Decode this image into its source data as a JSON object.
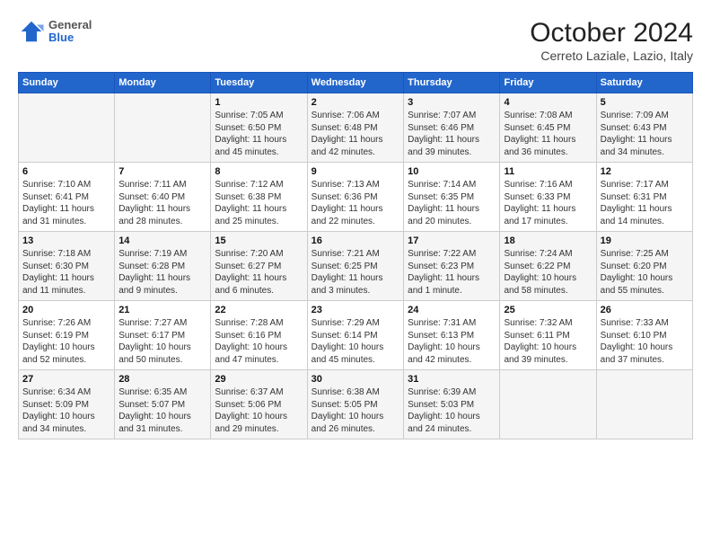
{
  "header": {
    "logo_general": "General",
    "logo_blue": "Blue",
    "title": "October 2024",
    "subtitle": "Cerreto Laziale, Lazio, Italy"
  },
  "days_of_week": [
    "Sunday",
    "Monday",
    "Tuesday",
    "Wednesday",
    "Thursday",
    "Friday",
    "Saturday"
  ],
  "weeks": [
    [
      {
        "day": "",
        "info": ""
      },
      {
        "day": "",
        "info": ""
      },
      {
        "day": "1",
        "info": "Sunrise: 7:05 AM\nSunset: 6:50 PM\nDaylight: 11 hours and 45 minutes."
      },
      {
        "day": "2",
        "info": "Sunrise: 7:06 AM\nSunset: 6:48 PM\nDaylight: 11 hours and 42 minutes."
      },
      {
        "day": "3",
        "info": "Sunrise: 7:07 AM\nSunset: 6:46 PM\nDaylight: 11 hours and 39 minutes."
      },
      {
        "day": "4",
        "info": "Sunrise: 7:08 AM\nSunset: 6:45 PM\nDaylight: 11 hours and 36 minutes."
      },
      {
        "day": "5",
        "info": "Sunrise: 7:09 AM\nSunset: 6:43 PM\nDaylight: 11 hours and 34 minutes."
      }
    ],
    [
      {
        "day": "6",
        "info": "Sunrise: 7:10 AM\nSunset: 6:41 PM\nDaylight: 11 hours and 31 minutes."
      },
      {
        "day": "7",
        "info": "Sunrise: 7:11 AM\nSunset: 6:40 PM\nDaylight: 11 hours and 28 minutes."
      },
      {
        "day": "8",
        "info": "Sunrise: 7:12 AM\nSunset: 6:38 PM\nDaylight: 11 hours and 25 minutes."
      },
      {
        "day": "9",
        "info": "Sunrise: 7:13 AM\nSunset: 6:36 PM\nDaylight: 11 hours and 22 minutes."
      },
      {
        "day": "10",
        "info": "Sunrise: 7:14 AM\nSunset: 6:35 PM\nDaylight: 11 hours and 20 minutes."
      },
      {
        "day": "11",
        "info": "Sunrise: 7:16 AM\nSunset: 6:33 PM\nDaylight: 11 hours and 17 minutes."
      },
      {
        "day": "12",
        "info": "Sunrise: 7:17 AM\nSunset: 6:31 PM\nDaylight: 11 hours and 14 minutes."
      }
    ],
    [
      {
        "day": "13",
        "info": "Sunrise: 7:18 AM\nSunset: 6:30 PM\nDaylight: 11 hours and 11 minutes."
      },
      {
        "day": "14",
        "info": "Sunrise: 7:19 AM\nSunset: 6:28 PM\nDaylight: 11 hours and 9 minutes."
      },
      {
        "day": "15",
        "info": "Sunrise: 7:20 AM\nSunset: 6:27 PM\nDaylight: 11 hours and 6 minutes."
      },
      {
        "day": "16",
        "info": "Sunrise: 7:21 AM\nSunset: 6:25 PM\nDaylight: 11 hours and 3 minutes."
      },
      {
        "day": "17",
        "info": "Sunrise: 7:22 AM\nSunset: 6:23 PM\nDaylight: 11 hours and 1 minute."
      },
      {
        "day": "18",
        "info": "Sunrise: 7:24 AM\nSunset: 6:22 PM\nDaylight: 10 hours and 58 minutes."
      },
      {
        "day": "19",
        "info": "Sunrise: 7:25 AM\nSunset: 6:20 PM\nDaylight: 10 hours and 55 minutes."
      }
    ],
    [
      {
        "day": "20",
        "info": "Sunrise: 7:26 AM\nSunset: 6:19 PM\nDaylight: 10 hours and 52 minutes."
      },
      {
        "day": "21",
        "info": "Sunrise: 7:27 AM\nSunset: 6:17 PM\nDaylight: 10 hours and 50 minutes."
      },
      {
        "day": "22",
        "info": "Sunrise: 7:28 AM\nSunset: 6:16 PM\nDaylight: 10 hours and 47 minutes."
      },
      {
        "day": "23",
        "info": "Sunrise: 7:29 AM\nSunset: 6:14 PM\nDaylight: 10 hours and 45 minutes."
      },
      {
        "day": "24",
        "info": "Sunrise: 7:31 AM\nSunset: 6:13 PM\nDaylight: 10 hours and 42 minutes."
      },
      {
        "day": "25",
        "info": "Sunrise: 7:32 AM\nSunset: 6:11 PM\nDaylight: 10 hours and 39 minutes."
      },
      {
        "day": "26",
        "info": "Sunrise: 7:33 AM\nSunset: 6:10 PM\nDaylight: 10 hours and 37 minutes."
      }
    ],
    [
      {
        "day": "27",
        "info": "Sunrise: 6:34 AM\nSunset: 5:09 PM\nDaylight: 10 hours and 34 minutes."
      },
      {
        "day": "28",
        "info": "Sunrise: 6:35 AM\nSunset: 5:07 PM\nDaylight: 10 hours and 31 minutes."
      },
      {
        "day": "29",
        "info": "Sunrise: 6:37 AM\nSunset: 5:06 PM\nDaylight: 10 hours and 29 minutes."
      },
      {
        "day": "30",
        "info": "Sunrise: 6:38 AM\nSunset: 5:05 PM\nDaylight: 10 hours and 26 minutes."
      },
      {
        "day": "31",
        "info": "Sunrise: 6:39 AM\nSunset: 5:03 PM\nDaylight: 10 hours and 24 minutes."
      },
      {
        "day": "",
        "info": ""
      },
      {
        "day": "",
        "info": ""
      }
    ]
  ]
}
